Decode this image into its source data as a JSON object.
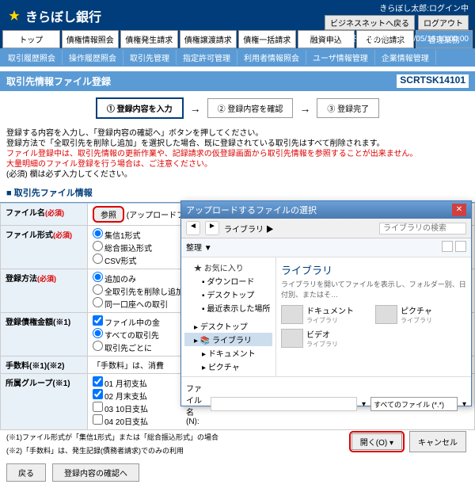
{
  "header": {
    "bank": "きらぼし銀行",
    "login_status": "きらぼし太郎:ログイン中",
    "btn_back": "ビジネスネットへ戻る",
    "btn_logout": "ログアウト",
    "last_op": "最終操作日時：2018/05/16 10:00:00"
  },
  "tabs": [
    "トップ",
    "債権情報照会",
    "債権発生請求",
    "債権譲渡請求",
    "債権一括請求",
    "融資申込",
    "その他請求",
    "管理業務"
  ],
  "subtabs": [
    "取引履歴照会",
    "操作履歴照会",
    "取引先管理",
    "指定許可管理",
    "利用者情報照会",
    "ユーザ情報管理",
    "企業情報管理"
  ],
  "page": {
    "title": "取引先情報ファイル登録",
    "code": "SCRTSK14101"
  },
  "steps": [
    "① 登録内容を入力",
    "② 登録内容を確認",
    "③ 登録完了"
  ],
  "notes": {
    "l1": "登録する内容を入力し、「登録内容の確認へ」ボタンを押してください。",
    "l2": "登録方法で「全取引先を削除し追加」を選択した場合、既に登録されている取引先はすべて削除されます。",
    "l3": "ファイル登録中は、取引先情報の更新作業や、記録請求の仮登録画面から取引先情報を参照することが出来ません。",
    "l4": "大量明細のファイル登録を行う場合は、ご注意ください。",
    "l5": "(必須) 欄は必ず入力してください。"
  },
  "section": "取引先ファイル情報",
  "form": {
    "file_label": "ファイル名",
    "req": "(必須)",
    "browse": "参照",
    "upload_hint": "(アップロードファイル選択)",
    "format_label": "ファイル形式",
    "formats": [
      "集信1形式",
      "総合振込形式",
      "CSV形式"
    ],
    "reg_label": "登録方法",
    "reg_opts": [
      "追加のみ",
      "全取引先を削除し追加",
      "同一口座への取引"
    ],
    "amount_label": "登録債権金額(※1)",
    "amount_opts": [
      "ファイル中の金",
      "すべての取引先",
      "取引先ごとに"
    ],
    "fee_label": "手数料(※1)(※2)",
    "fee_note": "「手数料」は、消費",
    "group_label": "所属グループ(※1)",
    "groups": [
      "01 月初支払",
      "02 月末支払",
      "03 10日支払",
      "04 20日支払"
    ]
  },
  "footnotes": {
    "f1": "(※1)ファイル形式が「集信1形式」または「総合振込形式」の場合",
    "f2": "(※2)「手数料」は、発生記録(債務者請求)でのみの利用"
  },
  "buttons": {
    "back": "戻る",
    "confirm": "登録内容の確認へ"
  },
  "dialog": {
    "title": "アップロードするファイルの選択",
    "path": "ライブラリ ▶",
    "search_ph": "ライブラリの検索",
    "organize": "整理 ▼",
    "side": {
      "fav": "★ お気に入り",
      "dl": "ダウンロード",
      "dt": "デスクトップ",
      "rc": "最近表示した場所",
      "desk": "デスクトップ",
      "lib": "ライブラリ",
      "doc": "ドキュメント",
      "pic": "ピクチャ",
      "vid": "ビデオ"
    },
    "main": {
      "title": "ライブラリ",
      "sub": "ライブラリを開いてファイルを表示し、フォルダー別、日付別、またはそ…",
      "items": [
        {
          "n": "ドキュメント",
          "s": "ライブラリ"
        },
        {
          "n": "ピクチャ",
          "s": "ライブラリ"
        },
        {
          "n": "ビデオ",
          "s": "ライブラリ"
        }
      ]
    },
    "fname_label": "ファイル名(N):",
    "filter": "すべてのファイル (*.*)",
    "open": "開く(O)",
    "cancel": "キャンセル"
  }
}
